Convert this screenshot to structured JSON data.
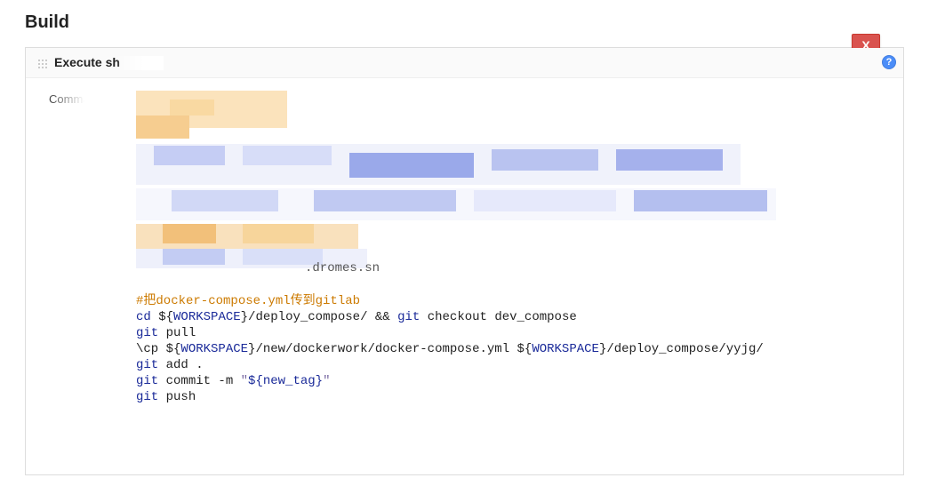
{
  "section": {
    "title": "Build"
  },
  "step": {
    "title_prefix": "Execute sh",
    "delete_label": "X",
    "help_label": "?",
    "field_label": "Comma"
  },
  "code": {
    "leftover_fragment": ".dromes.sn",
    "lines": {
      "l1": "#把docker-compose.yml传到gitlab",
      "l2": {
        "cmd": "cd",
        "a": " ${",
        "b": "WORKSPACE",
        "c": "}/deploy_compose/ && ",
        "d": "git",
        "e": " checkout dev_compose"
      },
      "l3": {
        "cmd": "git",
        "rest": " pull"
      },
      "l4": {
        "cmd": "\\cp ",
        "a": "${",
        "b": "WORKSPACE",
        "c": "}/new/dockerwork/docker-compose.yml ",
        "d": "${",
        "e": "WORKSPACE",
        "f": "}/deploy_compose/yyjg/"
      },
      "l5": {
        "cmd": "git",
        "rest": " add ."
      },
      "l6": {
        "cmd": "git",
        "a": " commit -m ",
        "q1": "\"",
        "b": "${new_tag}",
        "q2": "\""
      },
      "l7": {
        "cmd": "git",
        "rest": " push"
      }
    }
  }
}
